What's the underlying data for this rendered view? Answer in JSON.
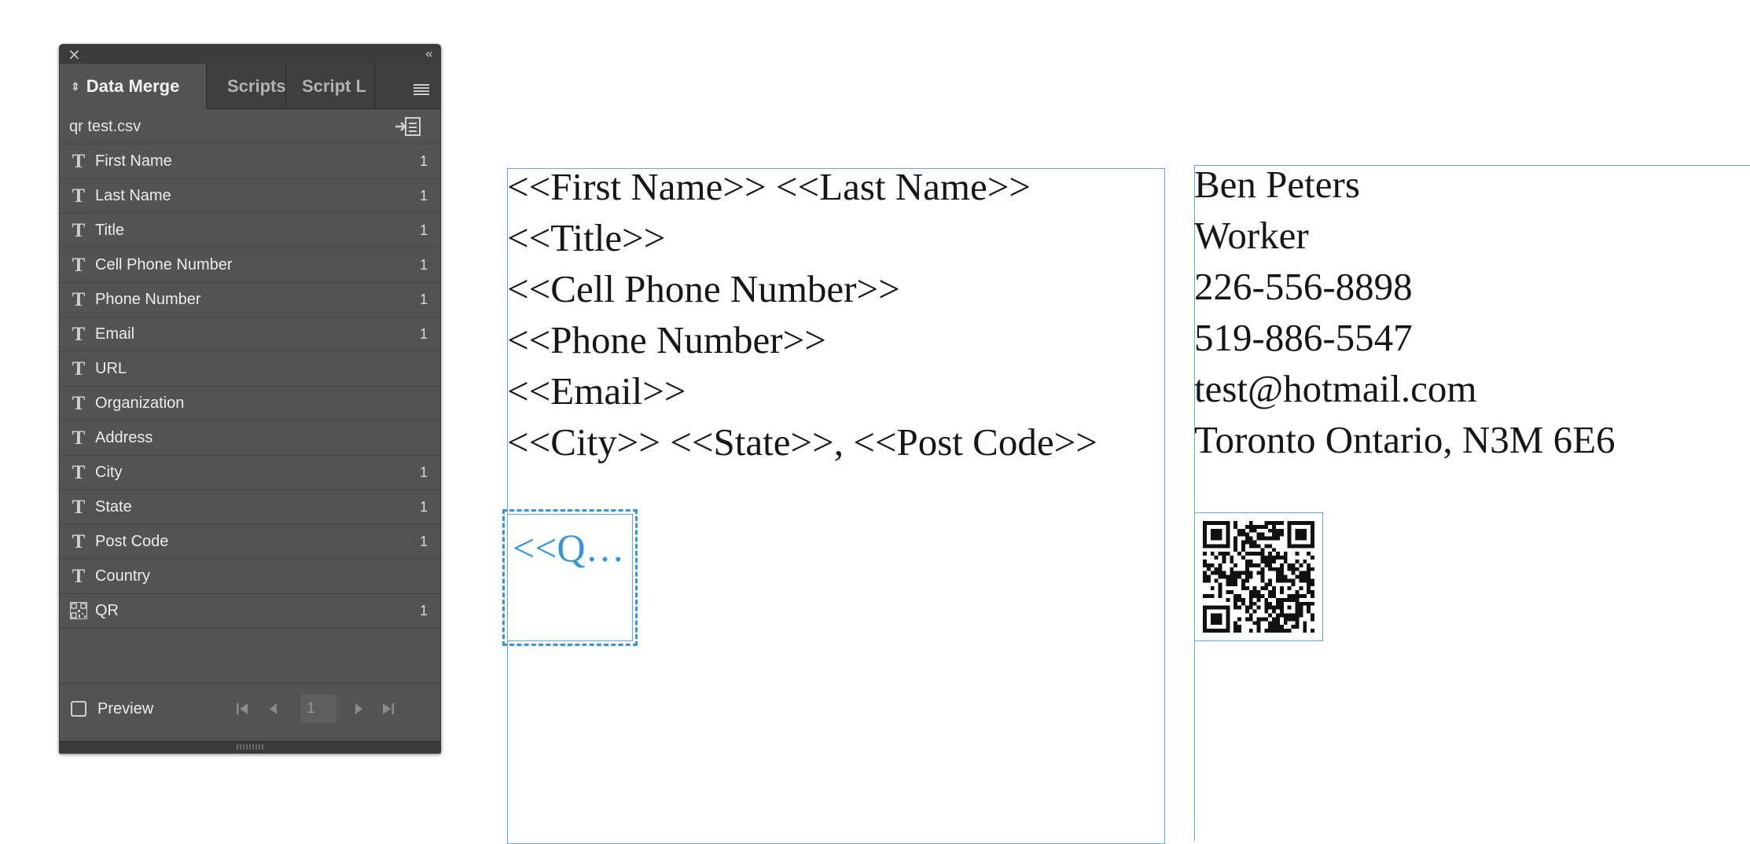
{
  "panel": {
    "close_glyph": "×",
    "collapse_glyph": "‹‹",
    "tabs": [
      {
        "label": "Data Merge",
        "active": true
      },
      {
        "label": "Scripts",
        "active": false
      },
      {
        "label": "Script L",
        "active": false
      }
    ],
    "data_source": "qr test.csv",
    "fields": [
      {
        "type": "text",
        "name": "First Name",
        "count": "1"
      },
      {
        "type": "text",
        "name": "Last Name",
        "count": "1"
      },
      {
        "type": "text",
        "name": "Title",
        "count": "1"
      },
      {
        "type": "text",
        "name": "Cell Phone Number",
        "count": "1"
      },
      {
        "type": "text",
        "name": "Phone Number",
        "count": "1"
      },
      {
        "type": "text",
        "name": "Email",
        "count": "1"
      },
      {
        "type": "text",
        "name": "URL",
        "count": ""
      },
      {
        "type": "text",
        "name": "Organization",
        "count": ""
      },
      {
        "type": "text",
        "name": "Address",
        "count": ""
      },
      {
        "type": "text",
        "name": "City",
        "count": "1"
      },
      {
        "type": "text",
        "name": "State",
        "count": "1"
      },
      {
        "type": "text",
        "name": "Post Code",
        "count": "1"
      },
      {
        "type": "text",
        "name": "Country",
        "count": ""
      },
      {
        "type": "image",
        "name": "QR",
        "count": "1"
      }
    ],
    "preview_label": "Preview",
    "preview_checked": false,
    "record_number": "1"
  },
  "template_card": {
    "lines": [
      "<<First Name>> <<Last Name>>",
      "<<Title>>",
      "<<Cell Phone Number>>",
      "<<Phone Number>>",
      "<<Email>>",
      "<<City>> <<State>>, <<Post Code>>"
    ],
    "qr_placeholder": "<<Q…"
  },
  "preview_card": {
    "lines": [
      "Ben Peters",
      "Worker",
      "226-556-8898",
      "519-886-5547",
      "test@hotmail.com",
      "Toronto Ontario, N3M 6E6"
    ],
    "qr_icon": "qr-code-image"
  },
  "colors": {
    "panel_bg": "#535353",
    "frame_accent": "#2f95e8"
  }
}
